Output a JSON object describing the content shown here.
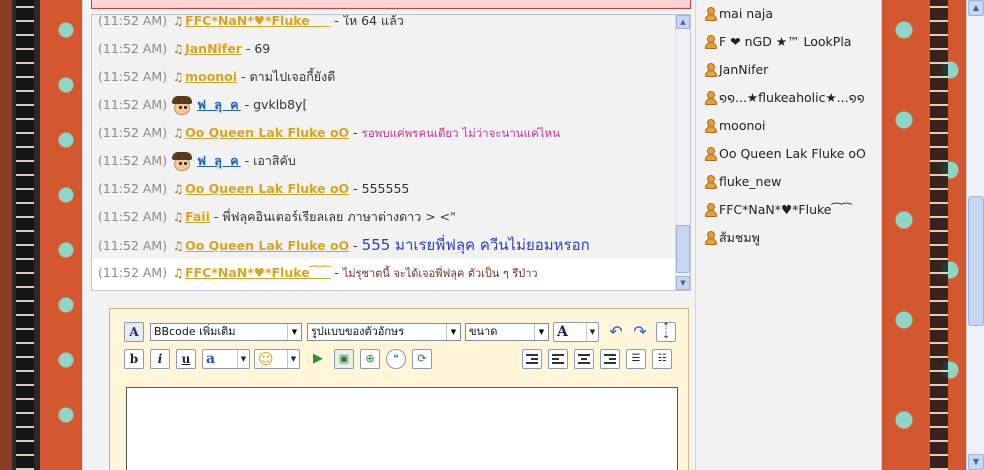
{
  "chat": {
    "messages": [
      {
        "time": "(11:52 AM)",
        "user": "FFC*NaN*♥*Fluke⁀⁀",
        "sep": " - ",
        "text": "ให 64 แล้ว",
        "user_style": "gold",
        "text_style": "normal",
        "icon": "music-note"
      },
      {
        "time": "(11:52 AM)",
        "user": "JanNifer",
        "sep": " - ",
        "text": "69",
        "user_style": "gold",
        "text_style": "normal",
        "icon": "music-note"
      },
      {
        "time": "(11:52 AM)",
        "user": "moonoi",
        "sep": " - ",
        "text": "ตามไปเจอกี้ยังดี",
        "user_style": "gold",
        "text_style": "normal",
        "icon": "music-note"
      },
      {
        "time": "(11:52 AM)",
        "user": "ฟ ลุ ค",
        "sep": " - ",
        "text": "gvklb8y[",
        "user_style": "blue",
        "text_style": "normal",
        "icon": "boy-face"
      },
      {
        "time": "(11:52 AM)",
        "user": "Oo Queen Lak Fluke oO",
        "sep": " - ",
        "text": "รอพบแค่พรคนเดียว ไม่ว่าจะนานแค่ไหน",
        "user_style": "gold",
        "text_style": "pink",
        "icon": "music-note"
      },
      {
        "time": "(11:52 AM)",
        "user": "ฟ ลุ ค",
        "sep": " - ",
        "text": "เอาสิคับ",
        "user_style": "blue",
        "text_style": "normal",
        "icon": "boy-face"
      },
      {
        "time": "(11:52 AM)",
        "user": "Oo Queen Lak Fluke oO",
        "sep": " - ",
        "text": "555555",
        "user_style": "gold",
        "text_style": "normal",
        "icon": "music-note"
      },
      {
        "time": "(11:52 AM)",
        "user": "Faii",
        "sep": " - ",
        "text": "พี่ฟลุคอินเตอร์เรียลเลย ภาษาต่างดาว > <\"",
        "user_style": "gold",
        "text_style": "normal",
        "icon": "music-note"
      },
      {
        "time": "(11:52 AM)",
        "user": "Oo Queen Lak Fluke oO",
        "sep": " - ",
        "text": "555 มาเรยพี่ฟลุค ควีนไม่ยอมหรอก",
        "user_style": "gold",
        "text_style": "blue-big",
        "icon": "music-note"
      },
      {
        "time": "(11:52 AM)",
        "user": "FFC*NaN*♥*Fluke⁀⁀",
        "sep": " - ",
        "text": "ไม่รุชาตนี้ จะได้เจอพี่ฟลุค ตัวเป็น ๆ รึป่าว",
        "user_style": "gold",
        "text_style": "maroon",
        "icon": "music-note"
      }
    ]
  },
  "online_users": [
    "mai naja",
    "F ❤ nGD ★™ LookPla",
    "JanNifer",
    "໑໑...★flukeaholic★...໑໑",
    "moonoi",
    "Oo Queen Lak Fluke oO",
    "fluke_new",
    "FFC*NaN*♥*Fluke⁀⁀",
    "ส้มชมพู"
  ],
  "editor": {
    "bbcode_select": "BBcode เพิ่มเติม",
    "font_select": "รูปแบบของตัวอักษร",
    "size_select": "ขนาด",
    "font_color_letter": "A",
    "bold_label": "b",
    "italic_label": "i",
    "underline_label": "u",
    "text_color_label": "a",
    "smiley_glyph": "☺",
    "message_text": ""
  },
  "colors": {
    "username_gold": "#d6a526",
    "username_blue": "#1f5fbf",
    "user_icon": "#e3a13b",
    "editor_bg": "#fff6d9"
  }
}
